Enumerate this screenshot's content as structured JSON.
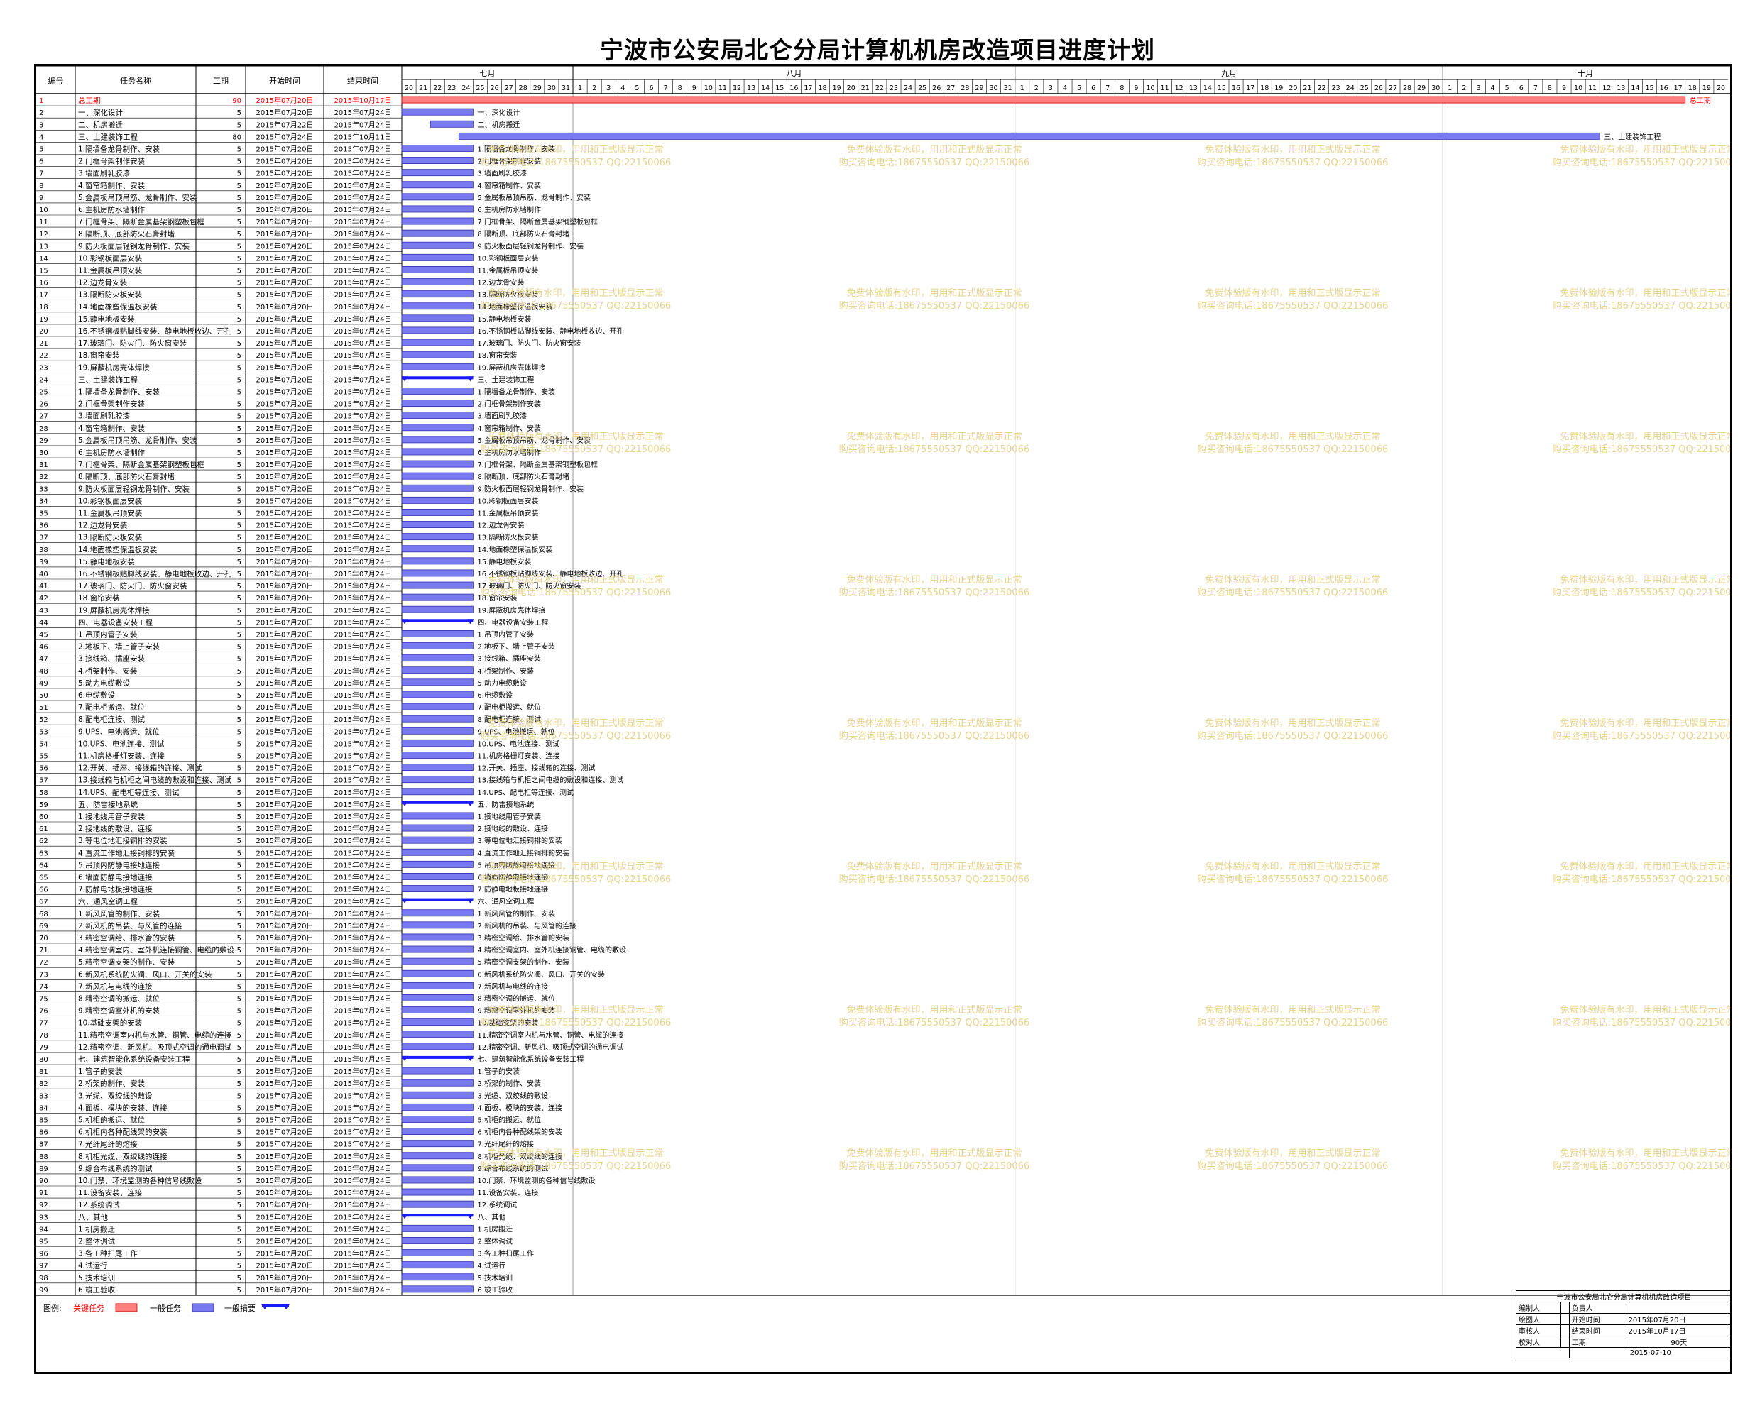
{
  "title": "宁波市公安局北仑分局计算机机房改造项目进度计划",
  "colors": {
    "critical": "#ff7f7f",
    "normal": "#7a7af0",
    "summary": "#1a1aff",
    "critical_text": "#ff0000"
  },
  "columns": {
    "id": "编号",
    "name": "任务名称",
    "duration": "工期",
    "start": "开始时间",
    "end": "结束时间"
  },
  "months": [
    "七月",
    "八月",
    "九月",
    "十月"
  ],
  "legend": {
    "label": "图例:",
    "critical": "关键任务",
    "normal": "一般任务",
    "summary": "一般摘要"
  },
  "watermark": {
    "line1": "免费体验版有水印，用用和正式版显示正常",
    "line2": "购买咨询电话:18675550537 QQ:22150066"
  },
  "tasks": [
    {
      "id": "1",
      "name": "总工期",
      "dur": "90",
      "start": "2015年07月20日",
      "end": "2015年10月17日",
      "type": "critical",
      "s": 0,
      "d": 90
    },
    {
      "id": "2",
      "name": "一、深化设计",
      "dur": "5",
      "start": "2015年07月20日",
      "end": "2015年07月24日",
      "type": "normal",
      "s": 0,
      "d": 5
    },
    {
      "id": "3",
      "name": "二、机房搬迁",
      "dur": "5",
      "start": "2015年07月22日",
      "end": "2015年07月24日",
      "type": "normal",
      "s": 2,
      "d": 3
    },
    {
      "id": "4",
      "name": "三、土建装饰工程",
      "dur": "80",
      "start": "2015年07月24日",
      "end": "2015年10月11日",
      "type": "normal",
      "s": 4,
      "d": 80
    },
    {
      "id": "5",
      "name": "1.隔墙备龙骨制作、安装",
      "dur": "5",
      "start": "2015年07月20日",
      "end": "2015年07月24日",
      "type": "normal",
      "s": 0,
      "d": 5
    },
    {
      "id": "6",
      "name": "2.门框骨架制作安装",
      "dur": "5",
      "start": "2015年07月20日",
      "end": "2015年07月24日",
      "type": "normal",
      "s": 0,
      "d": 5
    },
    {
      "id": "7",
      "name": "3.墙面刷乳胶漆",
      "dur": "5",
      "start": "2015年07月20日",
      "end": "2015年07月24日",
      "type": "normal",
      "s": 0,
      "d": 5
    },
    {
      "id": "8",
      "name": "4.窗帘箱制作、安装",
      "dur": "5",
      "start": "2015年07月20日",
      "end": "2015年07月24日",
      "type": "normal",
      "s": 0,
      "d": 5
    },
    {
      "id": "9",
      "name": "5.金属板吊顶吊筋、龙骨制作、安装",
      "dur": "5",
      "start": "2015年07月20日",
      "end": "2015年07月24日",
      "type": "normal",
      "s": 0,
      "d": 5
    },
    {
      "id": "10",
      "name": "6.主机房防水墙制作",
      "dur": "5",
      "start": "2015年07月20日",
      "end": "2015年07月24日",
      "type": "normal",
      "s": 0,
      "d": 5
    },
    {
      "id": "11",
      "name": "7.门框骨架、隔断金属基架钢塑板包框",
      "dur": "5",
      "start": "2015年07月20日",
      "end": "2015年07月24日",
      "type": "normal",
      "s": 0,
      "d": 5
    },
    {
      "id": "12",
      "name": "8.隔断顶、底部防火石膏封堵",
      "dur": "5",
      "start": "2015年07月20日",
      "end": "2015年07月24日",
      "type": "normal",
      "s": 0,
      "d": 5
    },
    {
      "id": "13",
      "name": "9.防火板面层轻钢龙骨制作、安装",
      "dur": "5",
      "start": "2015年07月20日",
      "end": "2015年07月24日",
      "type": "normal",
      "s": 0,
      "d": 5
    },
    {
      "id": "14",
      "name": "10.彩钢板面层安装",
      "dur": "5",
      "start": "2015年07月20日",
      "end": "2015年07月24日",
      "type": "normal",
      "s": 0,
      "d": 5
    },
    {
      "id": "15",
      "name": "11.金属板吊顶安装",
      "dur": "5",
      "start": "2015年07月20日",
      "end": "2015年07月24日",
      "type": "normal",
      "s": 0,
      "d": 5
    },
    {
      "id": "16",
      "name": "12.边龙骨安装",
      "dur": "5",
      "start": "2015年07月20日",
      "end": "2015年07月24日",
      "type": "normal",
      "s": 0,
      "d": 5
    },
    {
      "id": "17",
      "name": "13.隔断防火板安装",
      "dur": "5",
      "start": "2015年07月20日",
      "end": "2015年07月24日",
      "type": "normal",
      "s": 0,
      "d": 5
    },
    {
      "id": "18",
      "name": "14.地面橡塑保温板安装",
      "dur": "5",
      "start": "2015年07月20日",
      "end": "2015年07月24日",
      "type": "normal",
      "s": 0,
      "d": 5
    },
    {
      "id": "19",
      "name": "15.静电地板安装",
      "dur": "5",
      "start": "2015年07月20日",
      "end": "2015年07月24日",
      "type": "normal",
      "s": 0,
      "d": 5
    },
    {
      "id": "20",
      "name": "16.不锈钢板贴脚线安装、静电地板收边、开孔",
      "dur": "5",
      "start": "2015年07月20日",
      "end": "2015年07月24日",
      "type": "normal",
      "s": 0,
      "d": 5
    },
    {
      "id": "21",
      "name": "17.玻璃门、防火门、防火窗安装",
      "dur": "5",
      "start": "2015年07月20日",
      "end": "2015年07月24日",
      "type": "normal",
      "s": 0,
      "d": 5
    },
    {
      "id": "22",
      "name": "18.窗帘安装",
      "dur": "5",
      "start": "2015年07月20日",
      "end": "2015年07月24日",
      "type": "normal",
      "s": 0,
      "d": 5
    },
    {
      "id": "23",
      "name": "19.屏蔽机房壳体焊接",
      "dur": "5",
      "start": "2015年07月20日",
      "end": "2015年07月24日",
      "type": "normal",
      "s": 0,
      "d": 5
    },
    {
      "id": "24",
      "name": "三、土建装饰工程",
      "dur": "5",
      "start": "2015年07月20日",
      "end": "2015年07月24日",
      "type": "summary",
      "s": 0,
      "d": 5
    },
    {
      "id": "25",
      "name": "1.隔墙备龙骨制作、安装",
      "dur": "5",
      "start": "2015年07月20日",
      "end": "2015年07月24日",
      "type": "normal",
      "s": 0,
      "d": 5
    },
    {
      "id": "26",
      "name": "2.门框骨架制作安装",
      "dur": "5",
      "start": "2015年07月20日",
      "end": "2015年07月24日",
      "type": "normal",
      "s": 0,
      "d": 5
    },
    {
      "id": "27",
      "name": "3.墙面刷乳胶漆",
      "dur": "5",
      "start": "2015年07月20日",
      "end": "2015年07月24日",
      "type": "normal",
      "s": 0,
      "d": 5
    },
    {
      "id": "28",
      "name": "4.窗帘箱制作、安装",
      "dur": "5",
      "start": "2015年07月20日",
      "end": "2015年07月24日",
      "type": "normal",
      "s": 0,
      "d": 5
    },
    {
      "id": "29",
      "name": "5.金属板吊顶吊筋、龙骨制作、安装",
      "dur": "5",
      "start": "2015年07月20日",
      "end": "2015年07月24日",
      "type": "normal",
      "s": 0,
      "d": 5
    },
    {
      "id": "30",
      "name": "6.主机房防水墙制作",
      "dur": "5",
      "start": "2015年07月20日",
      "end": "2015年07月24日",
      "type": "normal",
      "s": 0,
      "d": 5
    },
    {
      "id": "31",
      "name": "7.门框骨架、隔断金属基架钢塑板包框",
      "dur": "5",
      "start": "2015年07月20日",
      "end": "2015年07月24日",
      "type": "normal",
      "s": 0,
      "d": 5
    },
    {
      "id": "32",
      "name": "8.隔断顶、底部防火石膏封堵",
      "dur": "5",
      "start": "2015年07月20日",
      "end": "2015年07月24日",
      "type": "normal",
      "s": 0,
      "d": 5
    },
    {
      "id": "33",
      "name": "9.防火板面层轻钢龙骨制作、安装",
      "dur": "5",
      "start": "2015年07月20日",
      "end": "2015年07月24日",
      "type": "normal",
      "s": 0,
      "d": 5
    },
    {
      "id": "34",
      "name": "10.彩钢板面层安装",
      "dur": "5",
      "start": "2015年07月20日",
      "end": "2015年07月24日",
      "type": "normal",
      "s": 0,
      "d": 5
    },
    {
      "id": "35",
      "name": "11.金属板吊顶安装",
      "dur": "5",
      "start": "2015年07月20日",
      "end": "2015年07月24日",
      "type": "normal",
      "s": 0,
      "d": 5
    },
    {
      "id": "36",
      "name": "12.边龙骨安装",
      "dur": "5",
      "start": "2015年07月20日",
      "end": "2015年07月24日",
      "type": "normal",
      "s": 0,
      "d": 5
    },
    {
      "id": "37",
      "name": "13.隔断防火板安装",
      "dur": "5",
      "start": "2015年07月20日",
      "end": "2015年07月24日",
      "type": "normal",
      "s": 0,
      "d": 5
    },
    {
      "id": "38",
      "name": "14.地面橡塑保温板安装",
      "dur": "5",
      "start": "2015年07月20日",
      "end": "2015年07月24日",
      "type": "normal",
      "s": 0,
      "d": 5
    },
    {
      "id": "39",
      "name": "15.静电地板安装",
      "dur": "5",
      "start": "2015年07月20日",
      "end": "2015年07月24日",
      "type": "normal",
      "s": 0,
      "d": 5
    },
    {
      "id": "40",
      "name": "16.不锈钢板贴脚线安装、静电地板收边、开孔",
      "dur": "5",
      "start": "2015年07月20日",
      "end": "2015年07月24日",
      "type": "normal",
      "s": 0,
      "d": 5
    },
    {
      "id": "41",
      "name": "17.玻璃门、防火门、防火窗安装",
      "dur": "5",
      "start": "2015年07月20日",
      "end": "2015年07月24日",
      "type": "normal",
      "s": 0,
      "d": 5
    },
    {
      "id": "42",
      "name": "18.窗帘安装",
      "dur": "5",
      "start": "2015年07月20日",
      "end": "2015年07月24日",
      "type": "normal",
      "s": 0,
      "d": 5
    },
    {
      "id": "43",
      "name": "19.屏蔽机房壳体焊接",
      "dur": "5",
      "start": "2015年07月20日",
      "end": "2015年07月24日",
      "type": "normal",
      "s": 0,
      "d": 5
    },
    {
      "id": "44",
      "name": "四、电器设备安装工程",
      "dur": "5",
      "start": "2015年07月20日",
      "end": "2015年07月24日",
      "type": "summary",
      "s": 0,
      "d": 5
    },
    {
      "id": "45",
      "name": "1.吊顶内管子安装",
      "dur": "5",
      "start": "2015年07月20日",
      "end": "2015年07月24日",
      "type": "normal",
      "s": 0,
      "d": 5
    },
    {
      "id": "46",
      "name": "2.地板下、墙上管子安装",
      "dur": "5",
      "start": "2015年07月20日",
      "end": "2015年07月24日",
      "type": "normal",
      "s": 0,
      "d": 5
    },
    {
      "id": "47",
      "name": "3.接线箱、插座安装",
      "dur": "5",
      "start": "2015年07月20日",
      "end": "2015年07月24日",
      "type": "normal",
      "s": 0,
      "d": 5
    },
    {
      "id": "48",
      "name": "4.桥架制作、安装",
      "dur": "5",
      "start": "2015年07月20日",
      "end": "2015年07月24日",
      "type": "normal",
      "s": 0,
      "d": 5
    },
    {
      "id": "49",
      "name": "5.动力电缆敷设",
      "dur": "5",
      "start": "2015年07月20日",
      "end": "2015年07月24日",
      "type": "normal",
      "s": 0,
      "d": 5
    },
    {
      "id": "50",
      "name": "6.电缆敷设",
      "dur": "5",
      "start": "2015年07月20日",
      "end": "2015年07月24日",
      "type": "normal",
      "s": 0,
      "d": 5
    },
    {
      "id": "51",
      "name": "7.配电柜搬运、就位",
      "dur": "5",
      "start": "2015年07月20日",
      "end": "2015年07月24日",
      "type": "normal",
      "s": 0,
      "d": 5
    },
    {
      "id": "52",
      "name": "8.配电柜连接、测试",
      "dur": "5",
      "start": "2015年07月20日",
      "end": "2015年07月24日",
      "type": "normal",
      "s": 0,
      "d": 5
    },
    {
      "id": "53",
      "name": "9.UPS、电池搬运、就位",
      "dur": "5",
      "start": "2015年07月20日",
      "end": "2015年07月24日",
      "type": "normal",
      "s": 0,
      "d": 5
    },
    {
      "id": "54",
      "name": "10.UPS、电池连接、测试",
      "dur": "5",
      "start": "2015年07月20日",
      "end": "2015年07月24日",
      "type": "normal",
      "s": 0,
      "d": 5
    },
    {
      "id": "55",
      "name": "11.机房格栅灯安装、连接",
      "dur": "5",
      "start": "2015年07月20日",
      "end": "2015年07月24日",
      "type": "normal",
      "s": 0,
      "d": 5
    },
    {
      "id": "56",
      "name": "12.开关、插座、接线箱的连接、测试",
      "dur": "5",
      "start": "2015年07月20日",
      "end": "2015年07月24日",
      "type": "normal",
      "s": 0,
      "d": 5
    },
    {
      "id": "57",
      "name": "13.接线箱与机柜之间电缆的敷设和连接、测试",
      "dur": "5",
      "start": "2015年07月20日",
      "end": "2015年07月24日",
      "type": "normal",
      "s": 0,
      "d": 5
    },
    {
      "id": "58",
      "name": "14.UPS、配电柜等连接、测试",
      "dur": "5",
      "start": "2015年07月20日",
      "end": "2015年07月24日",
      "type": "normal",
      "s": 0,
      "d": 5
    },
    {
      "id": "59",
      "name": "五、防雷接地系统",
      "dur": "5",
      "start": "2015年07月20日",
      "end": "2015年07月24日",
      "type": "summary",
      "s": 0,
      "d": 5
    },
    {
      "id": "60",
      "name": "1.接地线用管子安装",
      "dur": "5",
      "start": "2015年07月20日",
      "end": "2015年07月24日",
      "type": "normal",
      "s": 0,
      "d": 5
    },
    {
      "id": "61",
      "name": "2.接地线的敷设、连接",
      "dur": "5",
      "start": "2015年07月20日",
      "end": "2015年07月24日",
      "type": "normal",
      "s": 0,
      "d": 5
    },
    {
      "id": "62",
      "name": "3.等电位地汇接铜排的安装",
      "dur": "5",
      "start": "2015年07月20日",
      "end": "2015年07月24日",
      "type": "normal",
      "s": 0,
      "d": 5
    },
    {
      "id": "63",
      "name": "4.直流工作地汇接铜排的安装",
      "dur": "5",
      "start": "2015年07月20日",
      "end": "2015年07月24日",
      "type": "normal",
      "s": 0,
      "d": 5
    },
    {
      "id": "64",
      "name": "5.吊顶内防静电接地连接",
      "dur": "5",
      "start": "2015年07月20日",
      "end": "2015年07月24日",
      "type": "normal",
      "s": 0,
      "d": 5
    },
    {
      "id": "65",
      "name": "6.墙面防静电接地连接",
      "dur": "5",
      "start": "2015年07月20日",
      "end": "2015年07月24日",
      "type": "normal",
      "s": 0,
      "d": 5
    },
    {
      "id": "66",
      "name": "7.防静电地板接地连接",
      "dur": "5",
      "start": "2015年07月20日",
      "end": "2015年07月24日",
      "type": "normal",
      "s": 0,
      "d": 5
    },
    {
      "id": "67",
      "name": "六、通风空调工程",
      "dur": "5",
      "start": "2015年07月20日",
      "end": "2015年07月24日",
      "type": "summary",
      "s": 0,
      "d": 5
    },
    {
      "id": "68",
      "name": "1.新风风管的制作、安装",
      "dur": "5",
      "start": "2015年07月20日",
      "end": "2015年07月24日",
      "type": "normal",
      "s": 0,
      "d": 5
    },
    {
      "id": "69",
      "name": "2.新风机的吊装、与风管的连接",
      "dur": "5",
      "start": "2015年07月20日",
      "end": "2015年07月24日",
      "type": "normal",
      "s": 0,
      "d": 5
    },
    {
      "id": "70",
      "name": "3.精密空调给、排水管的安装",
      "dur": "5",
      "start": "2015年07月20日",
      "end": "2015年07月24日",
      "type": "normal",
      "s": 0,
      "d": 5
    },
    {
      "id": "71",
      "name": "4.精密空调室内、室外机连接铜管、电缆的敷设",
      "dur": "5",
      "start": "2015年07月20日",
      "end": "2015年07月24日",
      "type": "normal",
      "s": 0,
      "d": 5
    },
    {
      "id": "72",
      "name": "5.精密空调支架的制作、安装",
      "dur": "5",
      "start": "2015年07月20日",
      "end": "2015年07月24日",
      "type": "normal",
      "s": 0,
      "d": 5
    },
    {
      "id": "73",
      "name": "6.新风机系统防火阀、风口、开关的安装",
      "dur": "5",
      "start": "2015年07月20日",
      "end": "2015年07月24日",
      "type": "normal",
      "s": 0,
      "d": 5
    },
    {
      "id": "74",
      "name": "7.新风机与电线的连接",
      "dur": "5",
      "start": "2015年07月20日",
      "end": "2015年07月24日",
      "type": "normal",
      "s": 0,
      "d": 5
    },
    {
      "id": "75",
      "name": "8.精密空调的搬运、就位",
      "dur": "5",
      "start": "2015年07月20日",
      "end": "2015年07月24日",
      "type": "normal",
      "s": 0,
      "d": 5
    },
    {
      "id": "76",
      "name": "9.精密空调室外机的安装",
      "dur": "5",
      "start": "2015年07月20日",
      "end": "2015年07月24日",
      "type": "normal",
      "s": 0,
      "d": 5
    },
    {
      "id": "77",
      "name": "10.基础支架的安装",
      "dur": "5",
      "start": "2015年07月20日",
      "end": "2015年07月24日",
      "type": "normal",
      "s": 0,
      "d": 5
    },
    {
      "id": "78",
      "name": "11.精密空调室内机与水管、铜管、电缆的连接",
      "dur": "5",
      "start": "2015年07月20日",
      "end": "2015年07月24日",
      "type": "normal",
      "s": 0,
      "d": 5
    },
    {
      "id": "79",
      "name": "12.精密空调、新风机、吸顶式空调的通电调试",
      "dur": "5",
      "start": "2015年07月20日",
      "end": "2015年07月24日",
      "type": "normal",
      "s": 0,
      "d": 5
    },
    {
      "id": "80",
      "name": "七、建筑智能化系统设备安装工程",
      "dur": "5",
      "start": "2015年07月20日",
      "end": "2015年07月24日",
      "type": "summary",
      "s": 0,
      "d": 5
    },
    {
      "id": "81",
      "name": "1.管子的安装",
      "dur": "5",
      "start": "2015年07月20日",
      "end": "2015年07月24日",
      "type": "normal",
      "s": 0,
      "d": 5
    },
    {
      "id": "82",
      "name": "2.桥架的制作、安装",
      "dur": "5",
      "start": "2015年07月20日",
      "end": "2015年07月24日",
      "type": "normal",
      "s": 0,
      "d": 5
    },
    {
      "id": "83",
      "name": "3.光缆、双绞线的敷设",
      "dur": "5",
      "start": "2015年07月20日",
      "end": "2015年07月24日",
      "type": "normal",
      "s": 0,
      "d": 5
    },
    {
      "id": "84",
      "name": "4.面板、模块的安装、连接",
      "dur": "5",
      "start": "2015年07月20日",
      "end": "2015年07月24日",
      "type": "normal",
      "s": 0,
      "d": 5
    },
    {
      "id": "85",
      "name": "5.机柜的搬运、就位",
      "dur": "5",
      "start": "2015年07月20日",
      "end": "2015年07月24日",
      "type": "normal",
      "s": 0,
      "d": 5
    },
    {
      "id": "86",
      "name": "6.机柜内各种配线架的安装",
      "dur": "5",
      "start": "2015年07月20日",
      "end": "2015年07月24日",
      "type": "normal",
      "s": 0,
      "d": 5
    },
    {
      "id": "87",
      "name": "7.光纤尾纤的熔接",
      "dur": "5",
      "start": "2015年07月20日",
      "end": "2015年07月24日",
      "type": "normal",
      "s": 0,
      "d": 5
    },
    {
      "id": "88",
      "name": "8.机柜光缆、双绞线的连接",
      "dur": "5",
      "start": "2015年07月20日",
      "end": "2015年07月24日",
      "type": "normal",
      "s": 0,
      "d": 5
    },
    {
      "id": "89",
      "name": "9.综合布线系统的测试",
      "dur": "5",
      "start": "2015年07月20日",
      "end": "2015年07月24日",
      "type": "normal",
      "s": 0,
      "d": 5
    },
    {
      "id": "90",
      "name": "10.门禁、环境监测的各种信号线敷设",
      "dur": "5",
      "start": "2015年07月20日",
      "end": "2015年07月24日",
      "type": "normal",
      "s": 0,
      "d": 5
    },
    {
      "id": "91",
      "name": "11.设备安装、连接",
      "dur": "5",
      "start": "2015年07月20日",
      "end": "2015年07月24日",
      "type": "normal",
      "s": 0,
      "d": 5
    },
    {
      "id": "92",
      "name": "12.系统调试",
      "dur": "5",
      "start": "2015年07月20日",
      "end": "2015年07月24日",
      "type": "normal",
      "s": 0,
      "d": 5
    },
    {
      "id": "93",
      "name": "八、其他",
      "dur": "5",
      "start": "2015年07月20日",
      "end": "2015年07月24日",
      "type": "summary",
      "s": 0,
      "d": 5
    },
    {
      "id": "94",
      "name": "1.机房搬迁",
      "dur": "5",
      "start": "2015年07月20日",
      "end": "2015年07月24日",
      "type": "normal",
      "s": 0,
      "d": 5
    },
    {
      "id": "95",
      "name": "2.整体调试",
      "dur": "5",
      "start": "2015年07月20日",
      "end": "2015年07月24日",
      "type": "normal",
      "s": 0,
      "d": 5
    },
    {
      "id": "96",
      "name": "3.各工种扫尾工作",
      "dur": "5",
      "start": "2015年07月20日",
      "end": "2015年07月24日",
      "type": "normal",
      "s": 0,
      "d": 5
    },
    {
      "id": "97",
      "name": "4.试运行",
      "dur": "5",
      "start": "2015年07月20日",
      "end": "2015年07月24日",
      "type": "normal",
      "s": 0,
      "d": 5
    },
    {
      "id": "98",
      "name": "5.技术培训",
      "dur": "5",
      "start": "2015年07月20日",
      "end": "2015年07月24日",
      "type": "normal",
      "s": 0,
      "d": 5
    },
    {
      "id": "99",
      "name": "6.竣工验收",
      "dur": "5",
      "start": "2015年07月20日",
      "end": "2015年07月24日",
      "type": "normal",
      "s": 0,
      "d": 5
    }
  ],
  "footer": {
    "project_name": "宁波市公安局北仑分局计算机机房改造项目",
    "editor_label": "编制人",
    "owner_label": "负责人",
    "drawer_label": "绘图人",
    "start_label": "开始时间",
    "start_value": "2015年07月20日",
    "reviewer_label": "审核人",
    "end_label": "结束时间",
    "end_value": "2015年10月17日",
    "checker_label": "校对人",
    "duration_label": "工期",
    "duration_value": "90天",
    "date": "2015-07-10"
  }
}
